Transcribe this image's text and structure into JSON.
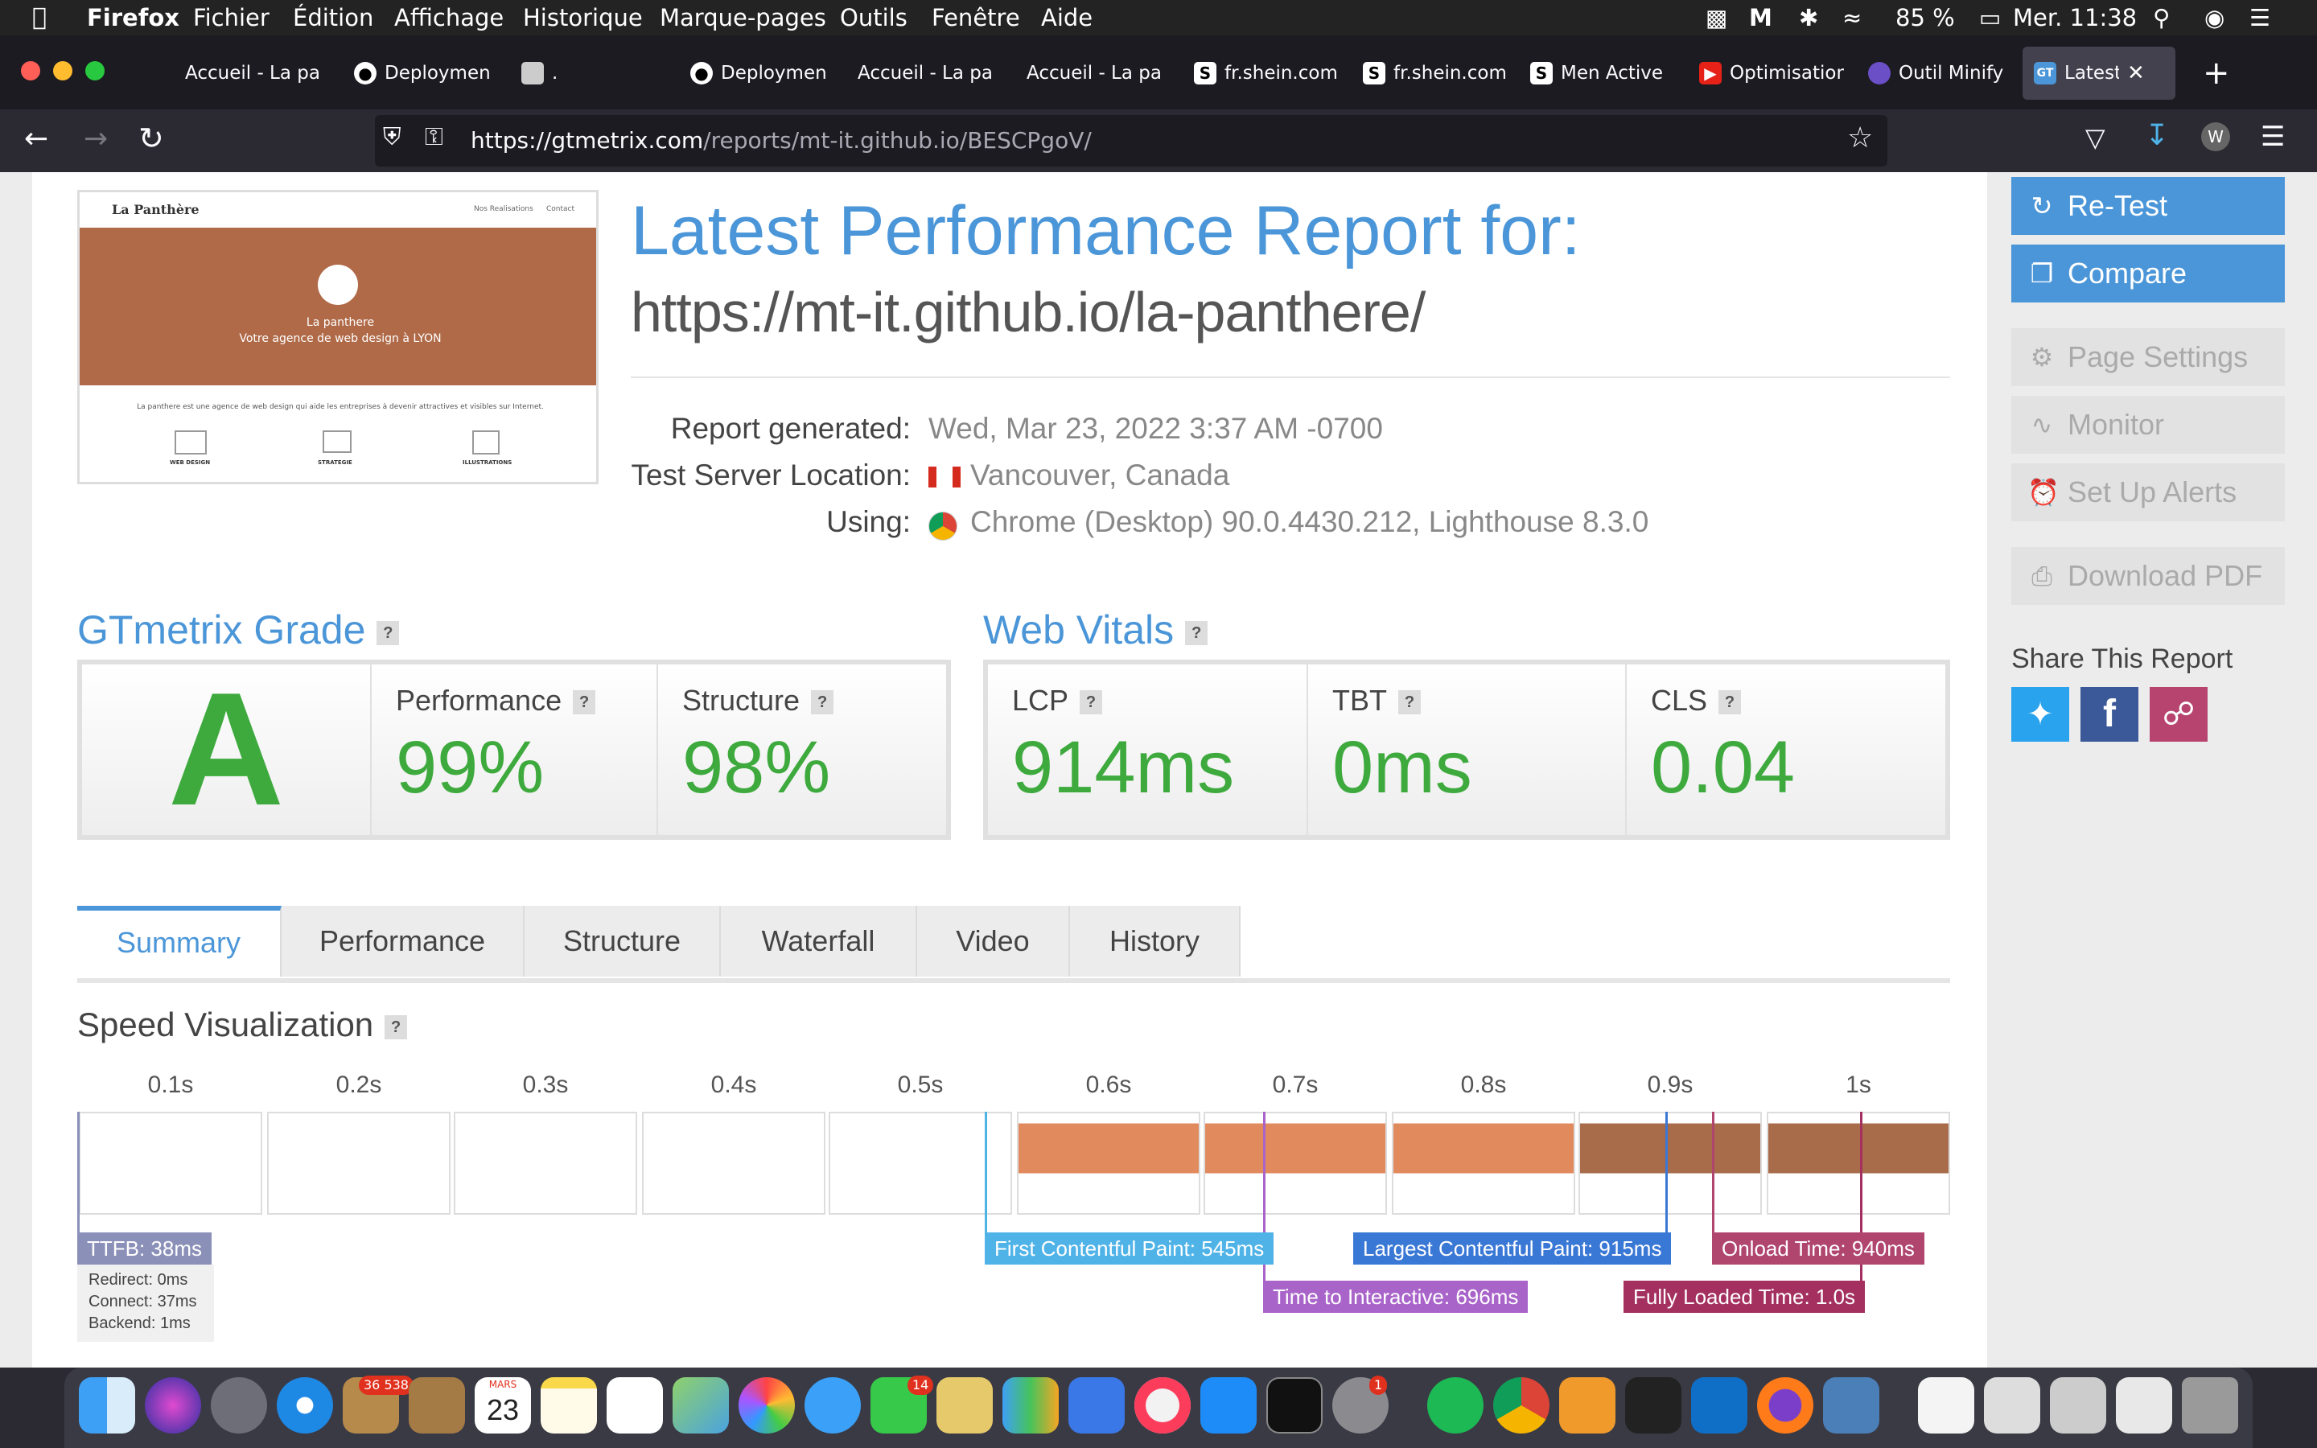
{
  "menubar": {
    "app": "Firefox",
    "items": [
      "Fichier",
      "Édition",
      "Affichage",
      "Historique",
      "Marque-pages",
      "Outils",
      "Fenêtre",
      "Aide"
    ],
    "battery": "85 %",
    "clock": "Mer. 11:38"
  },
  "tabs": [
    {
      "label": "Accueil - La par",
      "icon": "blank-tab-icon"
    },
    {
      "label": "Deploymen",
      "icon": "github-icon"
    },
    {
      "label": ".",
      "icon": "panther-favicon"
    },
    {
      "label": "Deploymen",
      "icon": "github-icon"
    },
    {
      "label": "Accueil - La par",
      "icon": "blank-tab-icon"
    },
    {
      "label": "Accueil - La par",
      "icon": "blank-tab-icon"
    },
    {
      "label": "fr.shein.com",
      "icon": "shein-icon"
    },
    {
      "label": "fr.shein.com",
      "icon": "shein-icon"
    },
    {
      "label": "Men Active",
      "icon": "shein-icon"
    },
    {
      "label": "Optimisation",
      "icon": "youtube-icon"
    },
    {
      "label": "Outil Minify",
      "icon": "minify-icon"
    },
    {
      "label": "Latest Pe",
      "icon": "gtmetrix-icon",
      "active": true
    }
  ],
  "url": {
    "host": "https://gtmetrix.com",
    "path": "/reports/mt-it.github.io/BESCPgoV/"
  },
  "report": {
    "title": "Latest Performance Report for:",
    "site_url": "https://mt-it.github.io/la-panthere/",
    "generated_label": "Report generated:",
    "generated_value": "Wed, Mar 23, 2022 3:37 AM -0700",
    "location_label": "Test Server Location:",
    "location_value": "Vancouver, Canada",
    "using_label": "Using:",
    "using_value": "Chrome (Desktop) 90.0.4430.212, Lighthouse 8.3.0"
  },
  "thumbnail": {
    "brand": "La Panthère",
    "nav1": "Nos Realisations",
    "nav2": "Contact",
    "hero_title": "La panthere",
    "hero_sub": "Votre agence de web design à LYON",
    "body": "La panthere est une agence de web design qui aide les entreprises à devenir attractives et visibles sur Internet.",
    "col1": "WEB DESIGN",
    "col2": "STRATEGIE",
    "col3": "ILLUSTRATIONS"
  },
  "grade": {
    "heading": "GTmetrix Grade",
    "letter": "A",
    "perf_label": "Performance",
    "perf_value": "99%",
    "struct_label": "Structure",
    "struct_value": "98%"
  },
  "vitals": {
    "heading": "Web Vitals",
    "lcp_label": "LCP",
    "lcp_value": "914ms",
    "tbt_label": "TBT",
    "tbt_value": "0ms",
    "cls_label": "CLS",
    "cls_value": "0.04"
  },
  "sidebar": {
    "retest": "Re-Test",
    "compare": "Compare",
    "page_settings": "Page Settings",
    "monitor": "Monitor",
    "alerts": "Set Up Alerts",
    "pdf": "Download PDF",
    "share": "Share This Report"
  },
  "report_tabs": [
    "Summary",
    "Performance",
    "Structure",
    "Waterfall",
    "Video",
    "History"
  ],
  "speed": {
    "heading": "Speed Visualization",
    "ticks": [
      "0.1s",
      "0.2s",
      "0.3s",
      "0.4s",
      "0.5s",
      "0.6s",
      "0.7s",
      "0.8s",
      "0.9s",
      "1s"
    ],
    "ttfb": "TTFB: 38ms",
    "redirect": "Redirect: 0ms",
    "connect": "Connect: 37ms",
    "backend": "Backend: 1ms",
    "fcp": "First Contentful Paint: 545ms",
    "tti": "Time to Interactive: 696ms",
    "lcp": "Largest Contentful Paint: 915ms",
    "onload": "Onload Time: 940ms",
    "fully": "Fully Loaded Time: 1.0s"
  },
  "dock": {
    "mail_badge": "36 538",
    "cal_month": "MARS",
    "cal_day": "23",
    "facetime_badge": "14",
    "prefs_badge": "1"
  },
  "colors": {
    "accent": "#4b96d8",
    "grade_green": "#3eaa3e",
    "fcp": "#4fb3e8",
    "tti": "#a964c9",
    "lcp": "#3a78d6",
    "onload": "#b0456e",
    "fully": "#a43060"
  }
}
